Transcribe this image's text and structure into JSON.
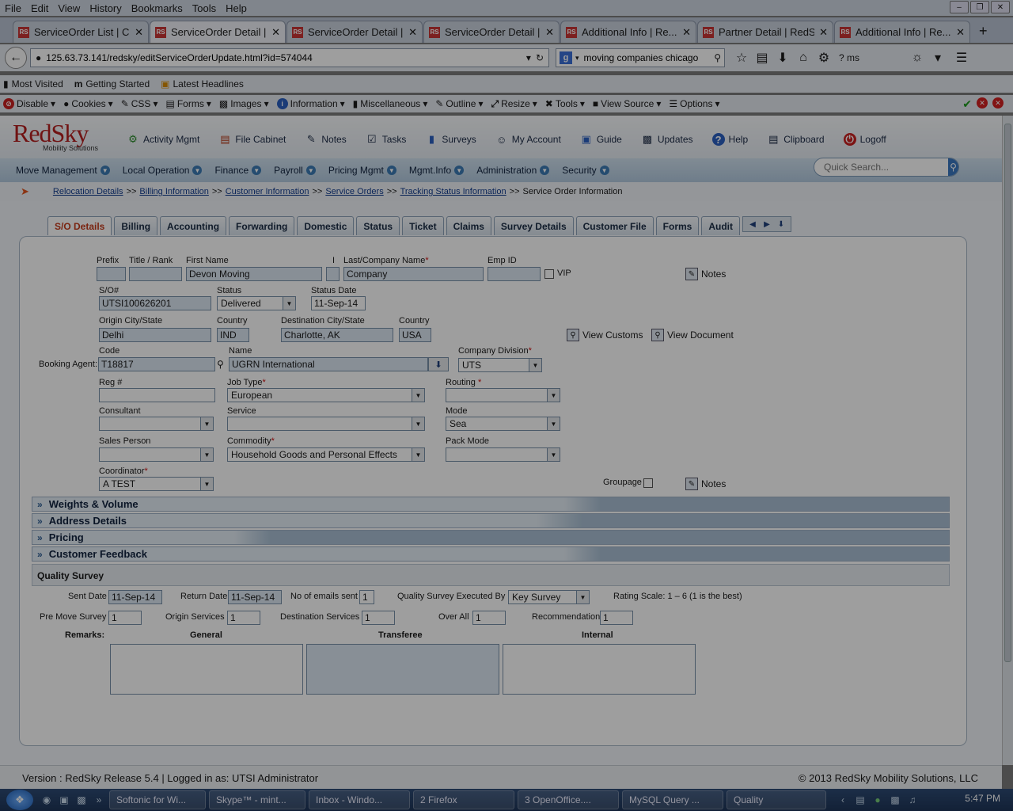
{
  "browser": {
    "menu": [
      "File",
      "Edit",
      "View",
      "History",
      "Bookmarks",
      "Tools",
      "Help"
    ],
    "tabs": [
      {
        "title": "ServiceOrder List | C...",
        "active": false
      },
      {
        "title": "ServiceOrder Detail |...",
        "active": true
      },
      {
        "title": "ServiceOrder Detail |...",
        "active": false
      },
      {
        "title": "ServiceOrder Detail |...",
        "active": false
      },
      {
        "title": "Additional Info | Re...",
        "active": false
      },
      {
        "title": "Partner Detail | RedS...",
        "active": false
      },
      {
        "title": "Additional Info | Re...",
        "active": false
      }
    ],
    "url": "125.63.73.141/redsky/editServiceOrderUpdate.html?id=574044",
    "search_value": "moving companies chicago",
    "extra_label": "? ms",
    "bookmarks": [
      "Most Visited",
      "Getting Started",
      "Latest Headlines"
    ],
    "webdev": [
      "Disable",
      "Cookies",
      "CSS",
      "Forms",
      "Images",
      "Information",
      "Miscellaneous",
      "Outline",
      "Resize",
      "Tools",
      "View Source",
      "Options"
    ]
  },
  "app": {
    "logo": "RedSky",
    "logo_sub": "Mobility Solutions",
    "top_menu": [
      "Activity Mgmt",
      "File Cabinet",
      "Notes",
      "Tasks",
      "Surveys",
      "My Account",
      "Guide",
      "Updates",
      "Help",
      "Clipboard",
      "Logoff"
    ],
    "main_nav": [
      "Move Management",
      "Local Operation",
      "Finance",
      "Payroll",
      "Pricing Mgmt",
      "Mgmt.Info",
      "Administration",
      "Security"
    ],
    "quick_search_placeholder": "Quick Search..."
  },
  "breadcrumb": {
    "links": [
      "Relocation Details",
      "Billing Information",
      "Customer Information",
      "Service Orders",
      "Tracking Status Information"
    ],
    "current": "Service Order Information",
    "sep": ">>"
  },
  "page_tabs": [
    "S/O Details",
    "Billing",
    "Accounting",
    "Forwarding",
    "Domestic",
    "Status",
    "Ticket",
    "Claims",
    "Survey Details",
    "Customer File",
    "Forms",
    "Audit"
  ],
  "form": {
    "labels": {
      "prefix": "Prefix",
      "title": "Title / Rank",
      "first": "First Name",
      "initial": "I",
      "last": "Last/Company Name",
      "emp": "Emp ID",
      "vip": "VIP",
      "notes": "Notes",
      "so": "S/O#",
      "status": "Status",
      "status_date": "Status Date",
      "origin": "Origin City/State",
      "country": "Country",
      "dest": "Destination City/State",
      "view_customs": "View Customs",
      "view_document": "View Document",
      "code": "Code",
      "name": "Name",
      "booking_agent": "Booking Agent:",
      "company_division": "Company Division",
      "reg": "Reg #",
      "job_type": "Job Type",
      "routing": "Routing",
      "consultant": "Consultant",
      "service": "Service",
      "mode": "Mode",
      "sales": "Sales Person",
      "commodity": "Commodity",
      "pack_mode": "Pack Mode",
      "coordinator": "Coordinator",
      "groupage": "Groupage"
    },
    "values": {
      "first": "Devon Moving",
      "last": "Company",
      "so": "UTSI100626201",
      "status": "Delivered",
      "status_date": "11-Sep-14",
      "origin": "Delhi",
      "origin_country": "IND",
      "dest": "Charlotte, AK",
      "dest_country": "USA",
      "code": "T18817",
      "name": "UGRN International",
      "company_division": "UTS",
      "job_type": "European",
      "mode": "Sea",
      "commodity": "Household Goods and Personal Effects",
      "coordinator": "A TEST"
    }
  },
  "sections": [
    "Weights & Volume",
    "Address Details",
    "Pricing",
    "Customer Feedback"
  ],
  "quality_survey": {
    "title": "Quality Survey",
    "labels": {
      "sent": "Sent Date",
      "return": "Return Date",
      "emails": "No of emails sent",
      "executed_by": "Quality Survey Executed By",
      "rating": "Rating Scale:  1 – 6 (1 is the best)",
      "pre_move": "Pre Move Survey",
      "origin_services": "Origin Services",
      "dest_services": "Destination Services",
      "over_all": "Over All",
      "recommendation": "Recommendation",
      "remarks": "Remarks:",
      "general": "General",
      "transferee": "Transferee",
      "internal": "Internal"
    },
    "values": {
      "sent": "11-Sep-14",
      "return": "11-Sep-14",
      "emails": "1",
      "executed_by": "Key Survey",
      "pre_move": "1",
      "origin_services": "1",
      "dest_services": "1",
      "over_all": "1",
      "recommendation": "1"
    }
  },
  "footer": {
    "left": "Version : RedSky Release 5.4 | Logged in as: UTSI Administrator",
    "right": "© 2013 RedSky Mobility Solutions, LLC"
  },
  "taskbar": {
    "items": [
      "Softonic for Wi...",
      "Skype™ - mint...",
      "Inbox - Windo...",
      "2 Firefox",
      "3 OpenOffice....",
      "MySQL Query ...",
      "Quality"
    ],
    "clock": "5:47 PM"
  }
}
